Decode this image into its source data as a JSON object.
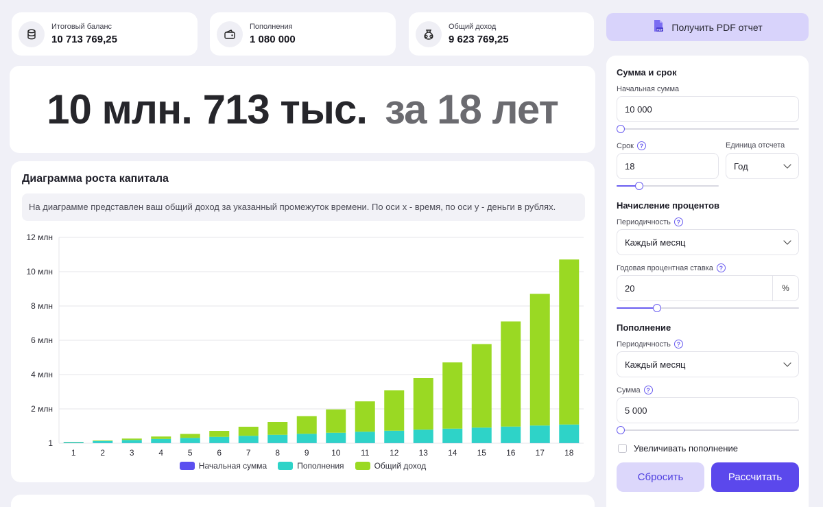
{
  "stats": [
    {
      "label": "Итоговый баланс",
      "value": "10 713 769,25",
      "icon": "coins-icon"
    },
    {
      "label": "Пополнения",
      "value": "1 080 000",
      "icon": "wallet-icon"
    },
    {
      "label": "Общий доход",
      "value": "9 623 769,25",
      "icon": "money-bag-icon"
    }
  ],
  "hero": {
    "amount": "10 млн. 713 тыс.",
    "period": "за 18 лет"
  },
  "chart": {
    "title": "Диаграмма роста капитала",
    "description": "На диаграмме представлен ваш общий доход за указанный промежуток времени. По оси x - время, по оси y - деньги в рублях."
  },
  "chart_data": {
    "type": "bar",
    "stacked": true,
    "categories": [
      "1",
      "2",
      "3",
      "4",
      "5",
      "6",
      "7",
      "8",
      "9",
      "10",
      "11",
      "12",
      "13",
      "14",
      "15",
      "16",
      "17",
      "18"
    ],
    "y_tick_labels": [
      "1",
      "2 млн",
      "4 млн",
      "6 млн",
      "8 млн",
      "10 млн",
      "12 млн"
    ],
    "y_tick_values": [
      0,
      2,
      4,
      6,
      8,
      10,
      12
    ],
    "ylim": [
      0,
      12
    ],
    "y_unit": "млн",
    "series": [
      {
        "name": "Начальная сумма",
        "color": "#5b4ff0",
        "values": [
          0.01,
          0.01,
          0.01,
          0.01,
          0.01,
          0.01,
          0.01,
          0.01,
          0.01,
          0.01,
          0.01,
          0.01,
          0.01,
          0.01,
          0.01,
          0.01,
          0.01,
          0.01
        ]
      },
      {
        "name": "Пополнения",
        "color": "#2ed3c8",
        "values": [
          0.06,
          0.12,
          0.18,
          0.24,
          0.3,
          0.36,
          0.42,
          0.48,
          0.54,
          0.6,
          0.66,
          0.72,
          0.78,
          0.84,
          0.9,
          0.96,
          1.02,
          1.08
        ]
      },
      {
        "name": "Общий доход",
        "color": "#9ad923",
        "values": [
          0.01,
          0.03,
          0.08,
          0.14,
          0.23,
          0.35,
          0.53,
          0.75,
          1.03,
          1.36,
          1.77,
          2.35,
          3.01,
          3.86,
          4.87,
          6.13,
          7.68,
          9.62
        ]
      }
    ],
    "legend_position": "bottom",
    "grid": true
  },
  "pdf_button": {
    "label": "Получить PDF отчет",
    "icon": "pdf-icon"
  },
  "form": {
    "section_amount": "Сумма и срок",
    "initial_label": "Начальная сумма",
    "initial_value": "10 000",
    "initial_slider": 0.0,
    "term_label": "Срок",
    "term_value": "18",
    "term_slider": 0.2,
    "unit_label": "Единица отсчета",
    "unit_value": "Год",
    "section_interest": "Начисление процентов",
    "interest_period_label": "Периодичность",
    "interest_period_value": "Каждый месяц",
    "rate_label": "Годовая процентная ставка",
    "rate_value": "20",
    "rate_suffix": "%",
    "rate_slider": 0.21,
    "section_topup": "Пополнение",
    "topup_period_label": "Периодичность",
    "topup_period_value": "Каждый месяц",
    "topup_sum_label": "Сумма",
    "topup_sum_value": "5 000",
    "topup_slider": 0.0,
    "increase_label": "Увеличивать пополнение",
    "increase_checked": false,
    "help_glyph": "?",
    "reset_label": "Сбросить",
    "calc_label": "Рассчитать"
  }
}
